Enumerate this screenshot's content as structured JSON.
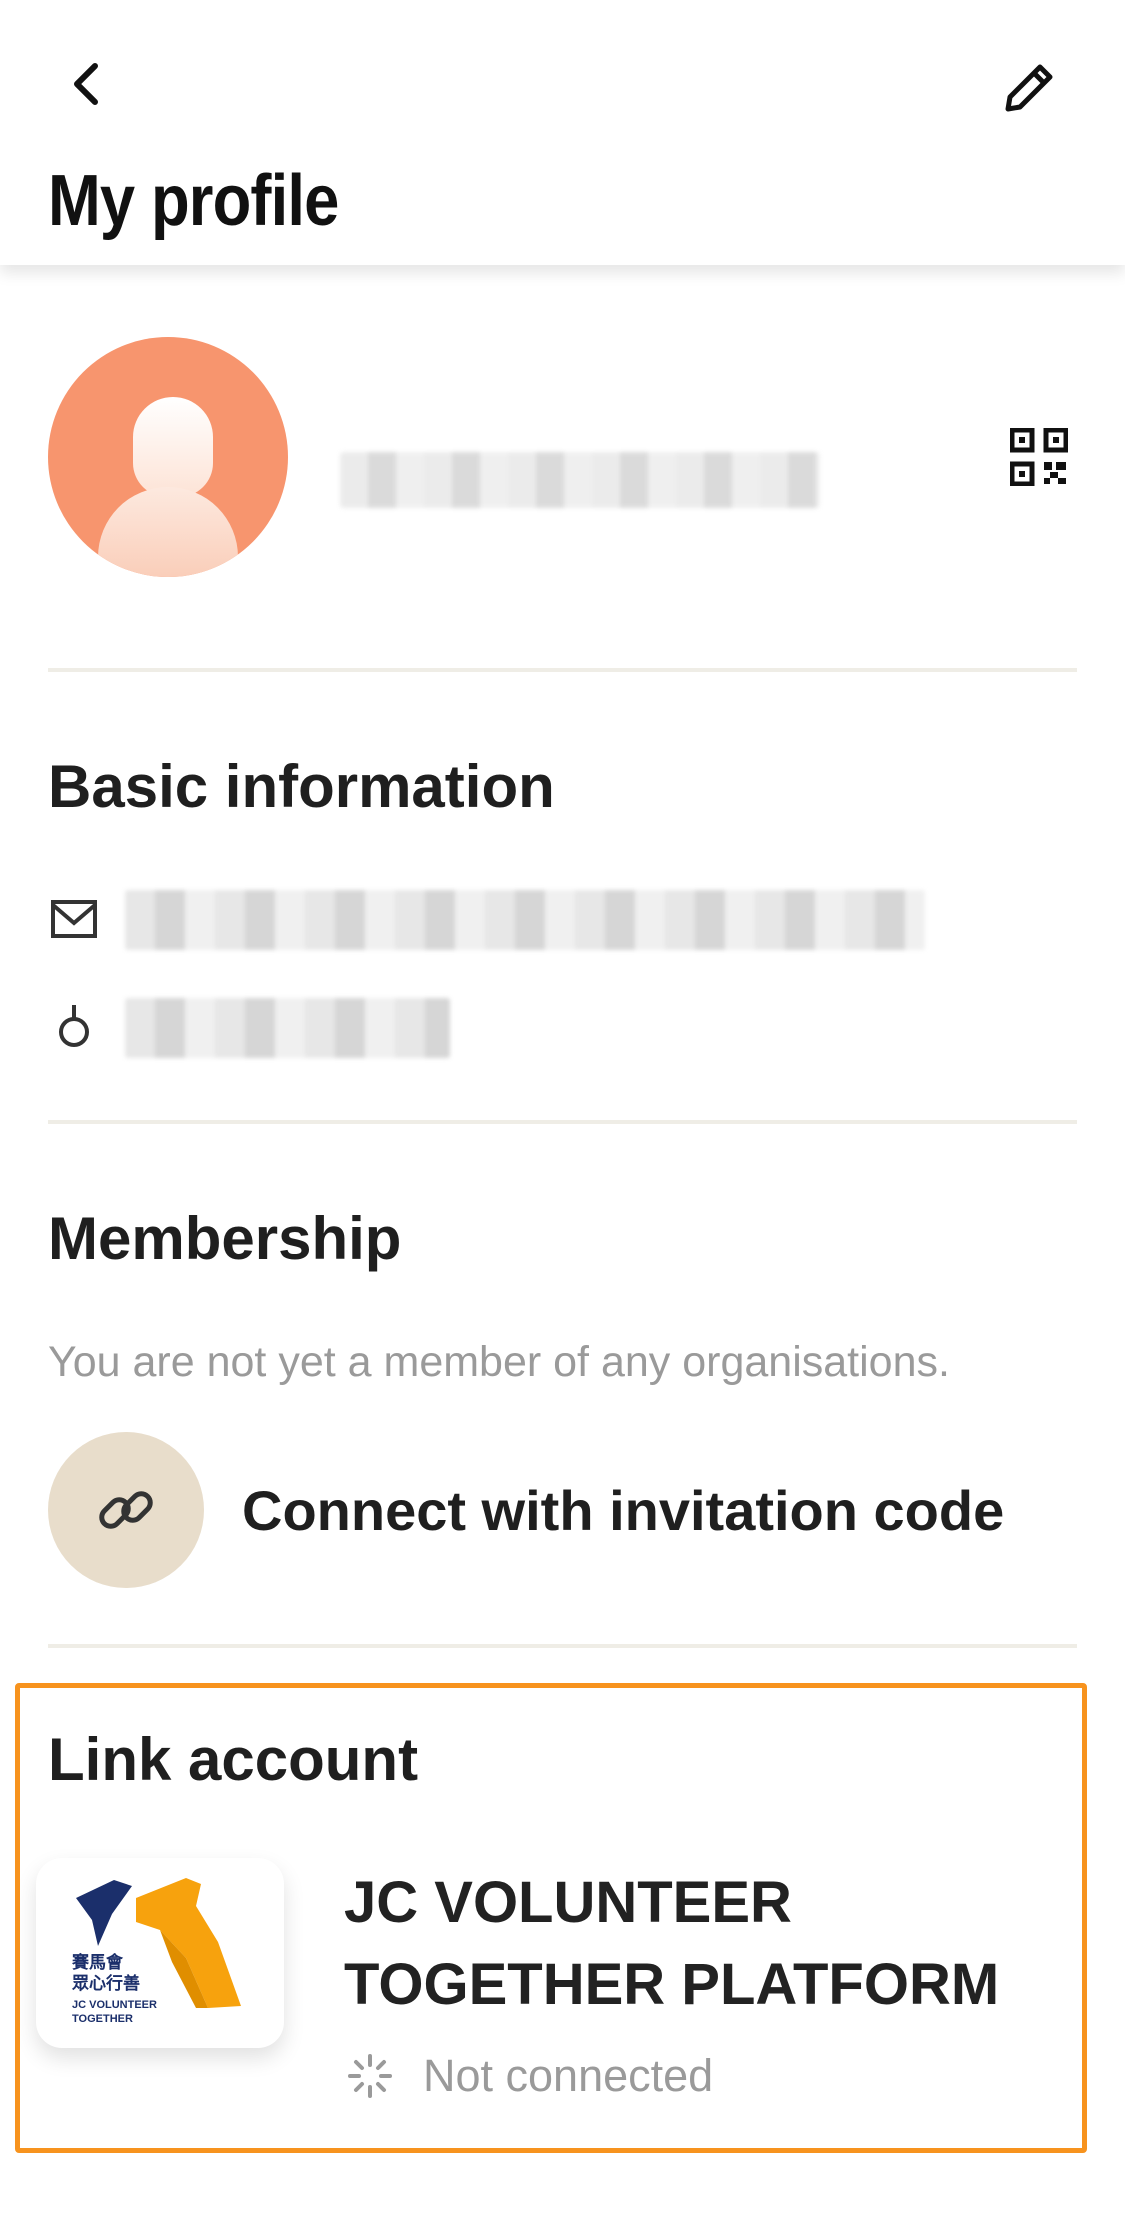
{
  "header": {
    "title": "My profile",
    "back_icon": "chevron-left-icon",
    "edit_icon": "pencil-icon"
  },
  "profile": {
    "avatar_icon": "user-avatar",
    "qr_icon": "qr-code-icon"
  },
  "basic_info": {
    "title": "Basic information",
    "email_icon": "envelope-icon",
    "gender_icon": "gender-icon"
  },
  "membership": {
    "title": "Membership",
    "note": "You are not yet a member of any organisations.",
    "invite_label": "Connect with invitation code",
    "invite_icon": "link-icon"
  },
  "link_account": {
    "title": "Link account",
    "platform_name": "JC VOLUNTEER TOGETHER PLATFORM",
    "status": "Not connected",
    "status_icon": "spinner-icon",
    "logo_text": {
      "line1": "賽馬會",
      "line2": "眾心行善",
      "line3": "JC VOLUNTEER",
      "line4": "TOGETHER"
    },
    "highlight_color": "#f7931e"
  },
  "colors": {
    "avatar_bg": "#f7956e",
    "invite_circle_bg": "#e8ddcb",
    "divider": "#efede6",
    "muted_text": "#9a9a9a"
  }
}
